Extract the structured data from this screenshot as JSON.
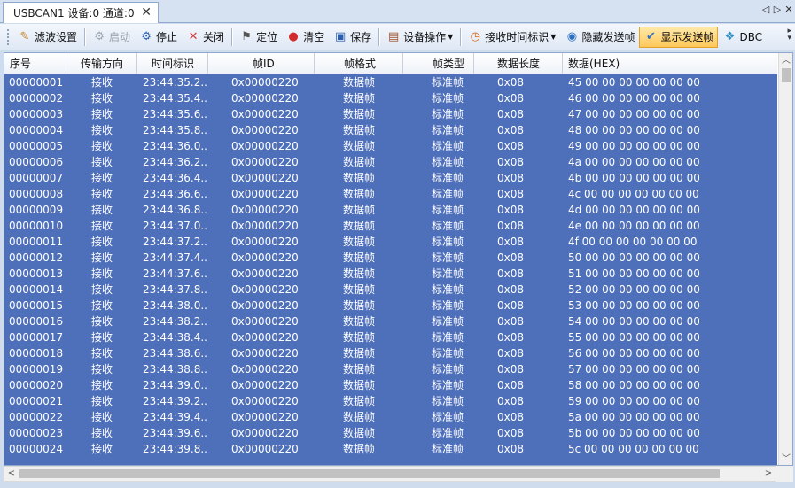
{
  "tab": {
    "title": "USBCAN1 设备:0 通道:0",
    "close": "✕"
  },
  "nav": {
    "prev": "◁",
    "next": "▷",
    "close": "✕"
  },
  "toolbar": {
    "filter": "滤波设置",
    "start": "启动",
    "stop": "停止",
    "close": "关闭",
    "locate": "定位",
    "clear": "清空",
    "save": "保存",
    "device_ops": "设备操作",
    "recv_time": "接收时间标识",
    "hide_sent": "隐藏发送帧",
    "show_sent": "显示发送帧",
    "dbc": "DBC"
  },
  "columns": [
    "序号",
    "传输方向",
    "时间标识",
    "帧ID",
    "帧格式",
    "帧类型",
    "数据长度",
    "数据(HEX)"
  ],
  "rows": [
    [
      "00000001",
      "接收",
      "23:44:35.2...",
      "0x00000220",
      "数据帧",
      "标准帧",
      "0x08",
      "45 00 00 00 00 00 00 00"
    ],
    [
      "00000002",
      "接收",
      "23:44:35.4...",
      "0x00000220",
      "数据帧",
      "标准帧",
      "0x08",
      "46 00 00 00 00 00 00 00"
    ],
    [
      "00000003",
      "接收",
      "23:44:35.6...",
      "0x00000220",
      "数据帧",
      "标准帧",
      "0x08",
      "47 00 00 00 00 00 00 00"
    ],
    [
      "00000004",
      "接收",
      "23:44:35.8...",
      "0x00000220",
      "数据帧",
      "标准帧",
      "0x08",
      "48 00 00 00 00 00 00 00"
    ],
    [
      "00000005",
      "接收",
      "23:44:36.0...",
      "0x00000220",
      "数据帧",
      "标准帧",
      "0x08",
      "49 00 00 00 00 00 00 00"
    ],
    [
      "00000006",
      "接收",
      "23:44:36.2...",
      "0x00000220",
      "数据帧",
      "标准帧",
      "0x08",
      "4a 00 00 00 00 00 00 00"
    ],
    [
      "00000007",
      "接收",
      "23:44:36.4...",
      "0x00000220",
      "数据帧",
      "标准帧",
      "0x08",
      "4b 00 00 00 00 00 00 00"
    ],
    [
      "00000008",
      "接收",
      "23:44:36.6...",
      "0x00000220",
      "数据帧",
      "标准帧",
      "0x08",
      "4c 00 00 00 00 00 00 00"
    ],
    [
      "00000009",
      "接收",
      "23:44:36.8...",
      "0x00000220",
      "数据帧",
      "标准帧",
      "0x08",
      "4d 00 00 00 00 00 00 00"
    ],
    [
      "00000010",
      "接收",
      "23:44:37.0...",
      "0x00000220",
      "数据帧",
      "标准帧",
      "0x08",
      "4e 00 00 00 00 00 00 00"
    ],
    [
      "00000011",
      "接收",
      "23:44:37.2...",
      "0x00000220",
      "数据帧",
      "标准帧",
      "0x08",
      "4f 00 00 00 00 00 00 00"
    ],
    [
      "00000012",
      "接收",
      "23:44:37.4...",
      "0x00000220",
      "数据帧",
      "标准帧",
      "0x08",
      "50 00 00 00 00 00 00 00"
    ],
    [
      "00000013",
      "接收",
      "23:44:37.6...",
      "0x00000220",
      "数据帧",
      "标准帧",
      "0x08",
      "51 00 00 00 00 00 00 00"
    ],
    [
      "00000014",
      "接收",
      "23:44:37.8...",
      "0x00000220",
      "数据帧",
      "标准帧",
      "0x08",
      "52 00 00 00 00 00 00 00"
    ],
    [
      "00000015",
      "接收",
      "23:44:38.0...",
      "0x00000220",
      "数据帧",
      "标准帧",
      "0x08",
      "53 00 00 00 00 00 00 00"
    ],
    [
      "00000016",
      "接收",
      "23:44:38.2...",
      "0x00000220",
      "数据帧",
      "标准帧",
      "0x08",
      "54 00 00 00 00 00 00 00"
    ],
    [
      "00000017",
      "接收",
      "23:44:38.4...",
      "0x00000220",
      "数据帧",
      "标准帧",
      "0x08",
      "55 00 00 00 00 00 00 00"
    ],
    [
      "00000018",
      "接收",
      "23:44:38.6...",
      "0x00000220",
      "数据帧",
      "标准帧",
      "0x08",
      "56 00 00 00 00 00 00 00"
    ],
    [
      "00000019",
      "接收",
      "23:44:38.8...",
      "0x00000220",
      "数据帧",
      "标准帧",
      "0x08",
      "57 00 00 00 00 00 00 00"
    ],
    [
      "00000020",
      "接收",
      "23:44:39.0...",
      "0x00000220",
      "数据帧",
      "标准帧",
      "0x08",
      "58 00 00 00 00 00 00 00"
    ],
    [
      "00000021",
      "接收",
      "23:44:39.2...",
      "0x00000220",
      "数据帧",
      "标准帧",
      "0x08",
      "59 00 00 00 00 00 00 00"
    ],
    [
      "00000022",
      "接收",
      "23:44:39.4...",
      "0x00000220",
      "数据帧",
      "标准帧",
      "0x08",
      "5a 00 00 00 00 00 00 00"
    ],
    [
      "00000023",
      "接收",
      "23:44:39.6...",
      "0x00000220",
      "数据帧",
      "标准帧",
      "0x08",
      "5b 00 00 00 00 00 00 00"
    ],
    [
      "00000024",
      "接收",
      "23:44:39.8...",
      "0x00000220",
      "数据帧",
      "标准帧",
      "0x08",
      "5c 00 00 00 00 00 00 00"
    ]
  ],
  "colors": {
    "selection": "#4e6fb9",
    "active_button": "#ffc85a",
    "header_bg": "#d6e2f2"
  },
  "icons": [
    "filter-icon",
    "start-icon",
    "stop-icon",
    "close-icon",
    "locate-icon",
    "clear-icon",
    "save-icon",
    "device-icon",
    "clock-icon",
    "hide-icon",
    "show-icon",
    "dbc-icon"
  ]
}
